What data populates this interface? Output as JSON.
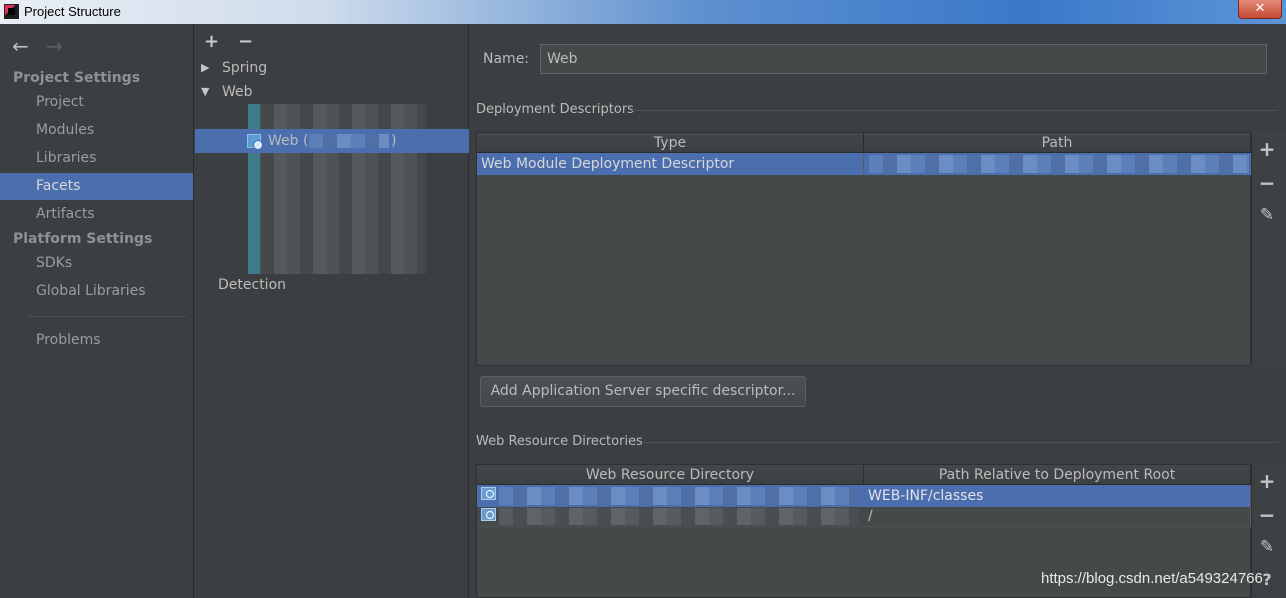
{
  "window": {
    "title": "Project Structure",
    "close_glyph": "✕"
  },
  "nav": {
    "back_glyph": "←",
    "forward_glyph": "→",
    "project_settings_header": "Project Settings",
    "project_items": [
      "Project",
      "Modules",
      "Libraries",
      "Facets",
      "Artifacts"
    ],
    "platform_settings_header": "Platform Settings",
    "platform_items": [
      "SDKs",
      "Global Libraries"
    ],
    "problems": "Problems",
    "selected": "Facets"
  },
  "tree": {
    "add_glyph": "+",
    "remove_glyph": "−",
    "expand_collapsed": "▶",
    "expand_open": "▼",
    "spring": "Spring",
    "web": "Web",
    "web_child": "Web (",
    "web_child_end": ")",
    "detection": "Detection"
  },
  "facet": {
    "name_label": "Name:",
    "name_value": "Web",
    "deployment_descriptors_title": "Deployment Descriptors",
    "dd_columns": [
      "Type",
      "Path"
    ],
    "dd_rows": [
      {
        "type": "Web Module Deployment Descriptor",
        "path": ""
      }
    ],
    "add_server_descriptor_button": "Add Application Server specific descriptor...",
    "web_resource_title": "Web Resource Directories",
    "wr_columns": [
      "Web Resource Directory",
      "Path Relative to Deployment Root"
    ],
    "wr_rows": [
      {
        "directory": "",
        "path": "WEB-INF/classes"
      },
      {
        "directory": "",
        "path": "/"
      }
    ],
    "side_add_glyph": "+",
    "side_remove_glyph": "−",
    "side_edit_glyph": "✎",
    "side_help_glyph": "?"
  },
  "watermark": "https://blog.csdn.net/a549324766",
  "colors": {
    "selection": "#4b6eaf",
    "panel": "#3c3f41",
    "text": "#bbbbbb"
  }
}
